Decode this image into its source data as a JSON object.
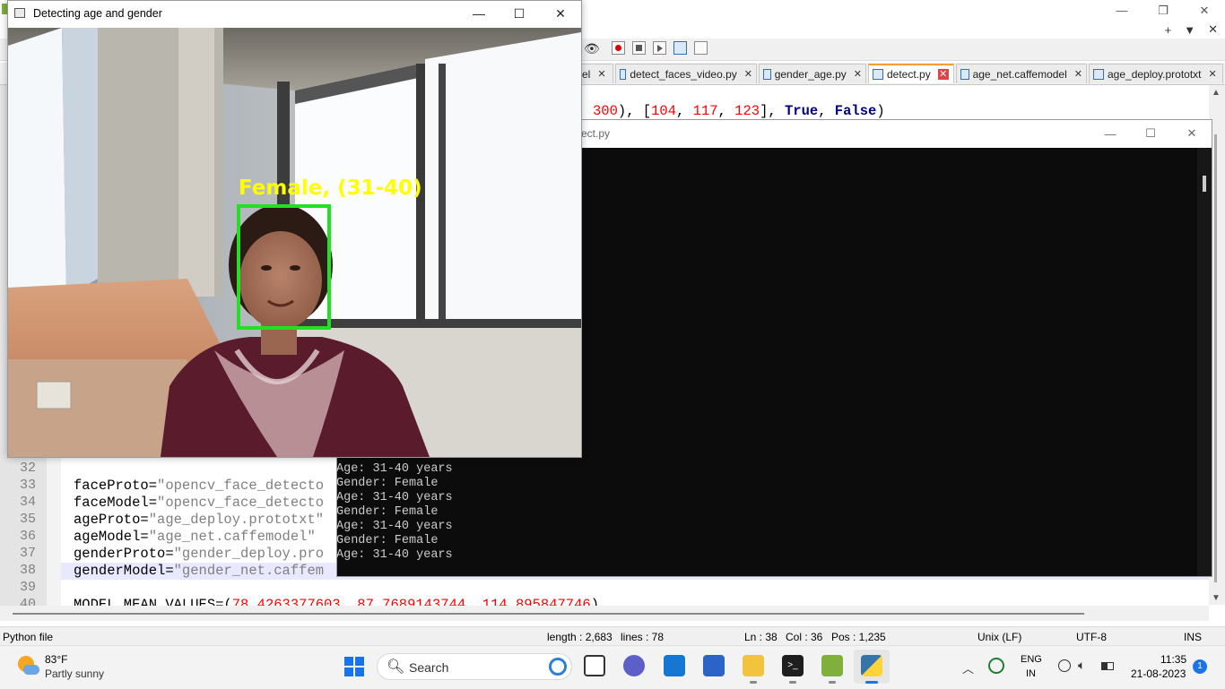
{
  "camera_window": {
    "title": "Detecting age and gender",
    "detection_label": "Female, (31-40)",
    "box_color": "#22e022",
    "label_color": "#ffff00"
  },
  "npp": {
    "toolbar_right": [
      "+",
      "▼",
      "✕"
    ],
    "tabs": [
      {
        "label": "el"
      },
      {
        "label": "detect_faces_video.py"
      },
      {
        "label": "gender_age.py"
      },
      {
        "label": "detect.py",
        "active": true
      },
      {
        "label": "age_net.caffemodel"
      },
      {
        "label": "age_deploy.prototxt"
      }
    ],
    "code_top_line": "300), [104, 117, 123], True, False)",
    "lines": [
      {
        "num": "32",
        "text": ""
      },
      {
        "num": "33",
        "text": "faceProto=\"opencv_face_detecto"
      },
      {
        "num": "34",
        "text": "faceModel=\"opencv_face_detecto"
      },
      {
        "num": "35",
        "text": "ageProto=\"age_deploy.prototxt\""
      },
      {
        "num": "36",
        "text": "ageModel=\"age_net.caffemodel\""
      },
      {
        "num": "37",
        "text": "genderProto=\"gender_deploy.pro"
      },
      {
        "num": "38",
        "text": "genderModel=\"gender_net.caffem"
      },
      {
        "num": "39",
        "text": ""
      },
      {
        "num": "40",
        "text": "MODEL_MEAN_VALUES=(78.4263377603, 87.7689143744, 114.895847746)"
      }
    ],
    "status": {
      "filetype": "Python file",
      "length": "length : 2,683",
      "lines": "lines : 78",
      "ln": "Ln : 38",
      "col": "Col : 36",
      "pos": "Pos : 1,235",
      "eol": "Unix (LF)",
      "encoding": "UTF-8",
      "mode": "INS"
    }
  },
  "console": {
    "title": "ect.py",
    "output": [
      "Gender: Female",
      "Age: 31-40 years",
      "Gender: Female",
      "Age: 31-40 years",
      "Gender: Female",
      "Age: 31-40 years",
      "Gender: Female",
      "Age: 31-40 years"
    ]
  },
  "taskbar": {
    "weather_temp": "83°F",
    "weather_desc": "Partly sunny",
    "search_placeholder": "Search",
    "lang_top": "ENG",
    "lang_bottom": "IN",
    "time": "11:35",
    "date": "21-08-2023",
    "notification_count": "1"
  }
}
